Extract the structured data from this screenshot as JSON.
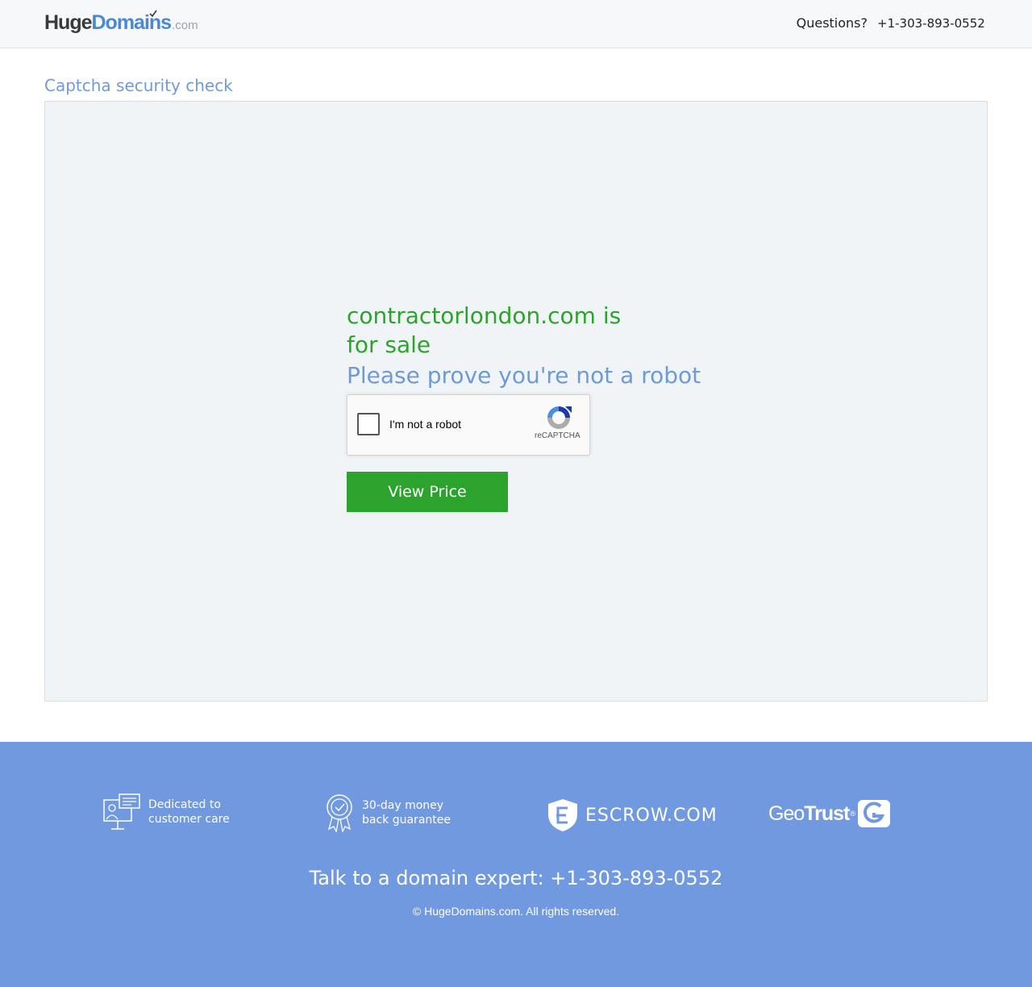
{
  "header": {
    "logo": {
      "part1": "Huge",
      "part2": "Domains",
      "part3": ".com"
    },
    "questions_label": "Questions?",
    "phone": "+1-303-893-0552"
  },
  "main": {
    "page_title": "Captcha security check",
    "sale_heading": "contractorlondon.com is for sale",
    "robot_heading": "Please prove you're not a robot",
    "recaptcha": {
      "label": "I'm not a robot",
      "brand": "reCAPTCHA"
    },
    "view_price_label": "View Price"
  },
  "footer": {
    "features": [
      {
        "icon": "customer-care-icon",
        "line1": "Dedicated to",
        "line2": "customer care"
      },
      {
        "icon": "guarantee-badge-icon",
        "line1": "30-day money",
        "line2": "back guarantee"
      }
    ],
    "escrow_label": "ESCROW.COM",
    "geotrust": {
      "part1": "Geo",
      "part2": "Trust",
      "reg": "®"
    },
    "expert_text": "Talk to a domain expert: +1-303-893-0552",
    "copyright": "© HugeDomains.com. All rights reserved."
  },
  "colors": {
    "accent_green": "#2ca32c",
    "accent_blue": "#6e9bd5",
    "footer_blue": "#7099df",
    "panel_bg": "#f1f4f7"
  }
}
